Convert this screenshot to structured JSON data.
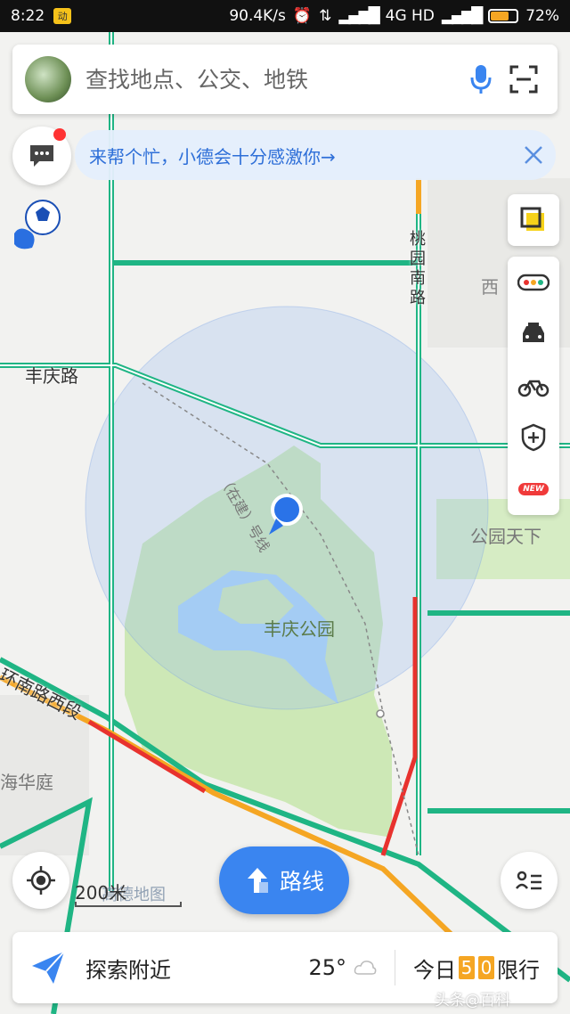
{
  "status_bar": {
    "time": "8:22",
    "app_badge": "动",
    "net_speed": "90.4K/s",
    "network": "4G HD",
    "battery": "72%",
    "battery_level": 0.72
  },
  "search": {
    "placeholder": "查找地点、公交、地铁"
  },
  "notice": {
    "text": "来帮个忙，小德会十分感激你→"
  },
  "map_labels": {
    "taoyuan_road": "桃园南路",
    "xi": "西",
    "fengqing_road": "丰庆路",
    "metro_line": "（在建）号线",
    "park_world": "公园天下",
    "fengqing_park": "丰庆公园",
    "ring_road": "环南路西段",
    "haihua": "海华庭"
  },
  "toolbar": {
    "new_badge": "NEW"
  },
  "scale": {
    "label": "200米",
    "logo": "高德地图"
  },
  "route_button": {
    "label": "路线"
  },
  "bottom_bar": {
    "explore_label": "探索附近",
    "temperature": "25°",
    "restriction_prefix": "今日",
    "restriction_num1": "5",
    "restriction_num2": "0",
    "restriction_suffix": "限行"
  },
  "watermark": "头条@百科",
  "colors": {
    "accent": "#3a85f0",
    "road_green": "#1fb584",
    "road_red": "#e8322e",
    "road_orange": "#f5a623",
    "park_green": "#cde8b6",
    "water": "#a9d3f5"
  }
}
